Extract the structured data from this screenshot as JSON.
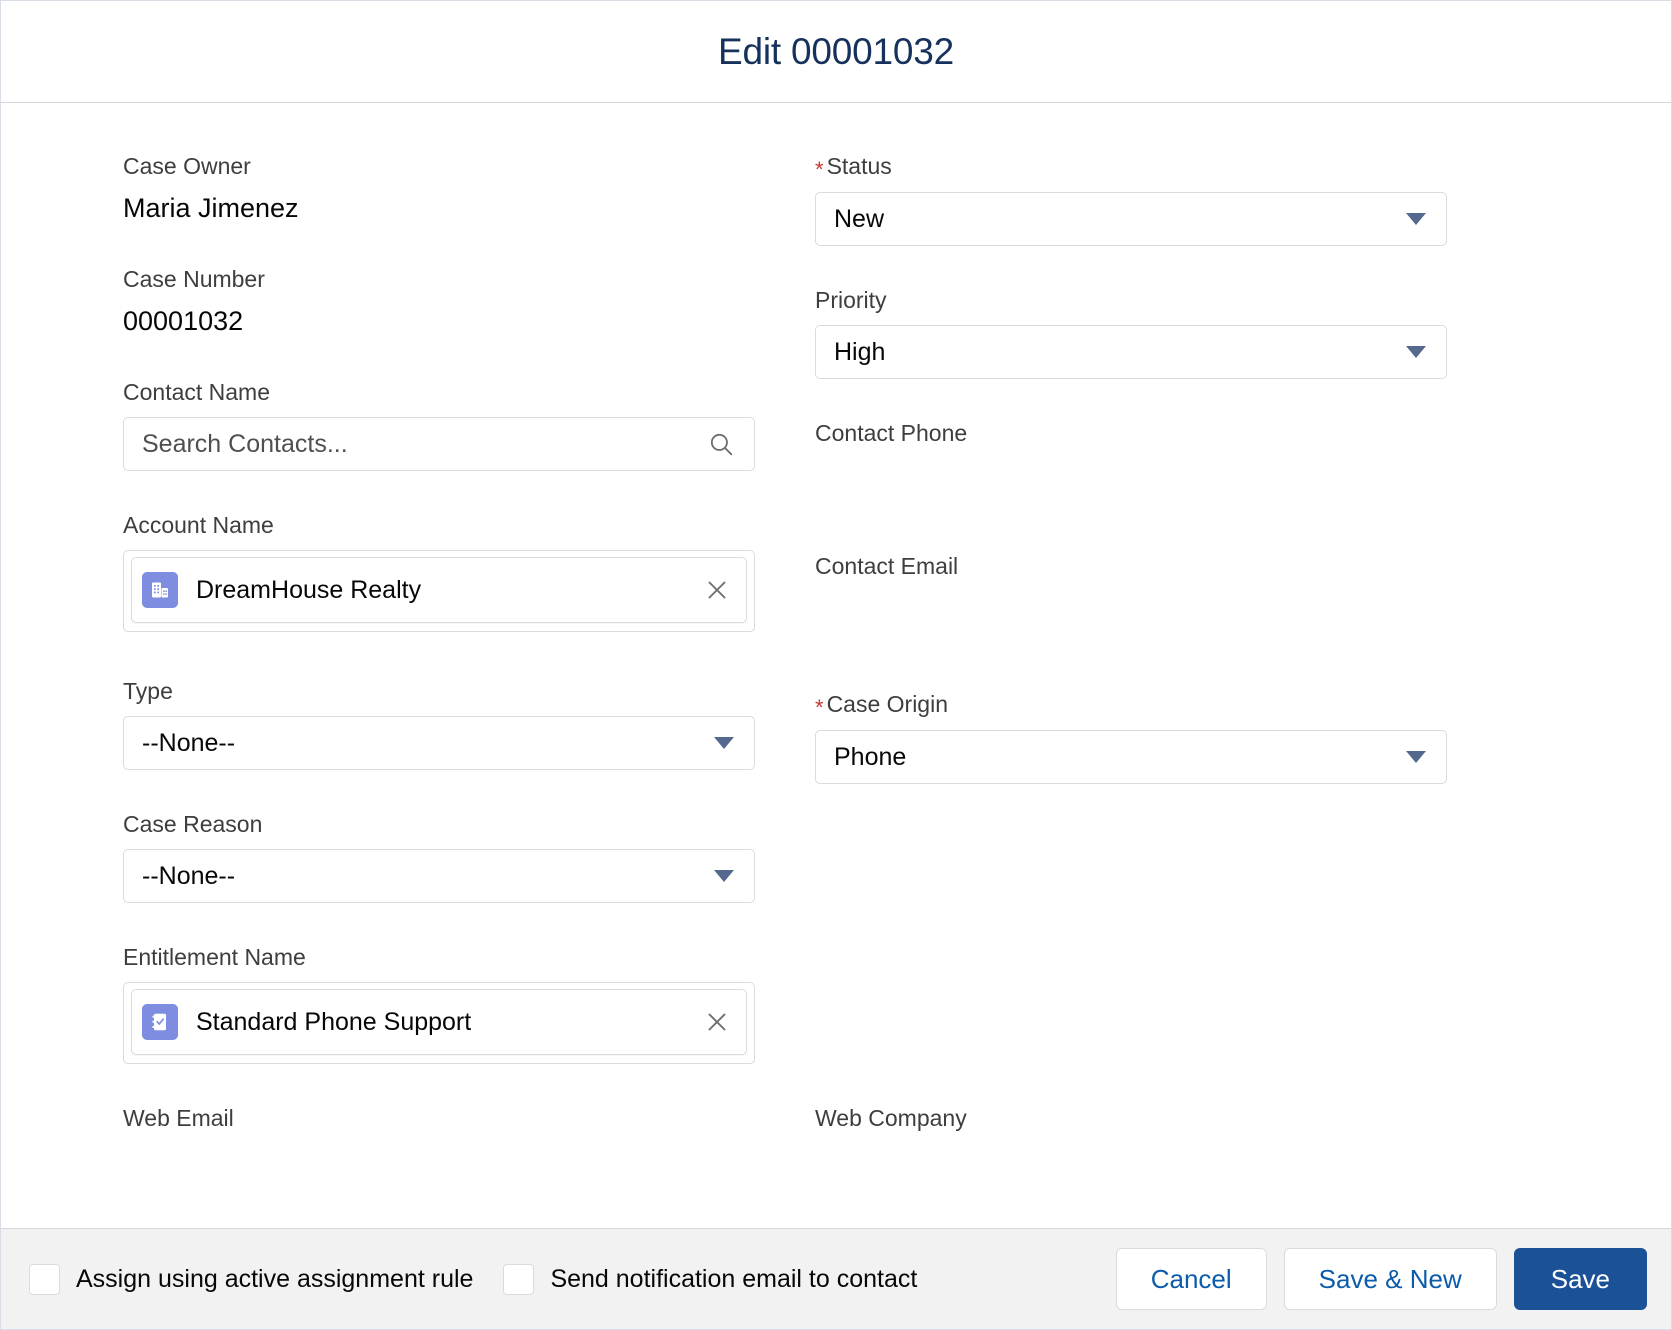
{
  "header": {
    "title": "Edit 00001032"
  },
  "form": {
    "left_column": [
      {
        "kind": "static",
        "name": "case-owner",
        "label": "Case Owner",
        "value": "Maria Jimenez"
      },
      {
        "kind": "static",
        "name": "case-number",
        "label": "Case Number",
        "value": "00001032"
      },
      {
        "kind": "lookup",
        "name": "contact-name",
        "label": "Contact Name",
        "placeholder": "Search Contacts...",
        "value": "",
        "icon": "search-icon"
      },
      {
        "kind": "pill",
        "name": "account-name",
        "label": "Account Name",
        "value": "DreamHouse Realty",
        "icon": "account-building-icon",
        "icon_color": "#7F8DE1",
        "remove_icon": "close-icon"
      },
      {
        "kind": "combobox",
        "name": "type",
        "label": "Type",
        "value": "--None--"
      },
      {
        "kind": "combobox",
        "name": "case-reason",
        "label": "Case Reason",
        "value": "--None--"
      },
      {
        "kind": "pill",
        "name": "entitlement-name",
        "label": "Entitlement Name",
        "value": "Standard Phone Support",
        "icon": "entitlement-clipboard-icon",
        "icon_color": "#7F8DE1",
        "remove_icon": "close-icon"
      }
    ],
    "right_column": [
      {
        "kind": "combobox",
        "name": "status",
        "label": "Status",
        "required": true,
        "value": "New"
      },
      {
        "kind": "combobox",
        "name": "priority",
        "label": "Priority",
        "required": false,
        "value": "High"
      },
      {
        "kind": "blank",
        "name": "contact-phone",
        "label": "Contact Phone",
        "value": ""
      },
      {
        "kind": "blank",
        "name": "contact-email",
        "label": "Contact Email",
        "value": ""
      },
      {
        "kind": "combobox",
        "name": "case-origin",
        "label": "Case Origin",
        "required": true,
        "value": "Phone"
      }
    ],
    "cutoff_labels": {
      "left": "Web Email",
      "right": "Web Company"
    }
  },
  "footer": {
    "checkboxes": [
      {
        "name": "assign-using-active-assignment-rule",
        "label": "Assign using active assignment rule",
        "checked": false
      },
      {
        "name": "send-notification-email-to-contact",
        "label": "Send notification email to contact",
        "checked": false
      }
    ],
    "buttons": {
      "cancel": "Cancel",
      "save_new": "Save & New",
      "save": "Save"
    }
  },
  "colors": {
    "brand_blue": "#1b5297",
    "link_blue": "#0b5cab",
    "required_red": "#c23934",
    "caret_slate": "#54698d",
    "icon_purple": "#7F8DE1",
    "footer_gray": "#f3f2f2",
    "border_gray": "#dddbda"
  }
}
